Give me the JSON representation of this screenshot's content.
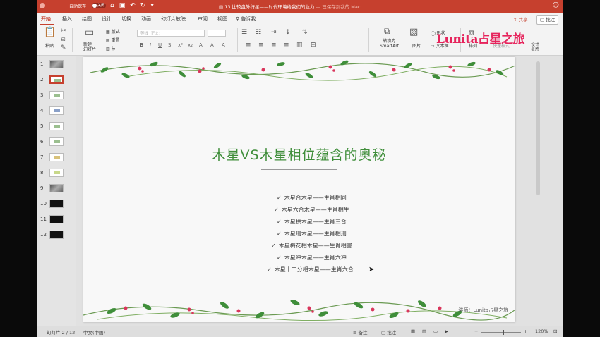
{
  "titlebar": {
    "autosave_label": "自动保存",
    "autosave_state": "关闭",
    "icons": [
      "home-icon",
      "save-icon",
      "undo-icon",
      "redo-icon",
      "customize-icon"
    ],
    "doc_title": "13.比较盘外行星——时代环境给我们的业力",
    "saved_status": " — 已保存到我的 Mac"
  },
  "tabs": [
    "开始",
    "插入",
    "绘图",
    "设计",
    "切换",
    "动画",
    "幻灯片放映",
    "审阅",
    "视图"
  ],
  "tell_me": "告诉我",
  "share": "共享",
  "comments": "批注",
  "ribbon": {
    "paste": "粘贴",
    "new_slide": "新建\n幻灯片",
    "layout": "版式",
    "reset": "重置",
    "section": "节",
    "font_placeholder": "等线 (正文)",
    "convert_smartart": "转换为\nSmartArt",
    "picture": "图片",
    "shapes": "形状",
    "textbox": "文本框",
    "arrange": "排列",
    "quick_styles": "快速样式",
    "design_ideas": "设计\n灵感"
  },
  "watermark": "Lunita占星之旅",
  "thumbnails": [
    {
      "num": "1",
      "kind": "photo"
    },
    {
      "num": "2",
      "kind": "selected"
    },
    {
      "num": "3",
      "kind": "light"
    },
    {
      "num": "4",
      "kind": "light"
    },
    {
      "num": "5",
      "kind": "light"
    },
    {
      "num": "6",
      "kind": "light"
    },
    {
      "num": "7",
      "kind": "light"
    },
    {
      "num": "8",
      "kind": "light"
    },
    {
      "num": "9",
      "kind": "photo"
    },
    {
      "num": "10",
      "kind": "dark"
    },
    {
      "num": "11",
      "kind": "dark"
    },
    {
      "num": "12",
      "kind": "dark"
    }
  ],
  "slide": {
    "title": "木星VS木星相位蕴含的奥秘",
    "bullets": [
      "木星合木星——生肖相同",
      "木星六合木星——生肖相生",
      "木星拱木星——生肖三合",
      "木星刑木星——生肖相刑",
      "木星梅花相木星——生肖相害",
      "木星冲木星——生肖六冲",
      "木星十二分相木星——生肖六合"
    ],
    "check_mark": "✓",
    "footer": "讲师：Lunita占星之旅"
  },
  "statusbar": {
    "slide_indicator": "幻灯片 2 / 12",
    "language": "中文(中国)",
    "notes": "备注",
    "comments": "批注",
    "zoom": "120%"
  },
  "colors": {
    "accent": "#c6402e",
    "title_green": "#3f8e3a",
    "watermark_pink": "#e6245c"
  }
}
